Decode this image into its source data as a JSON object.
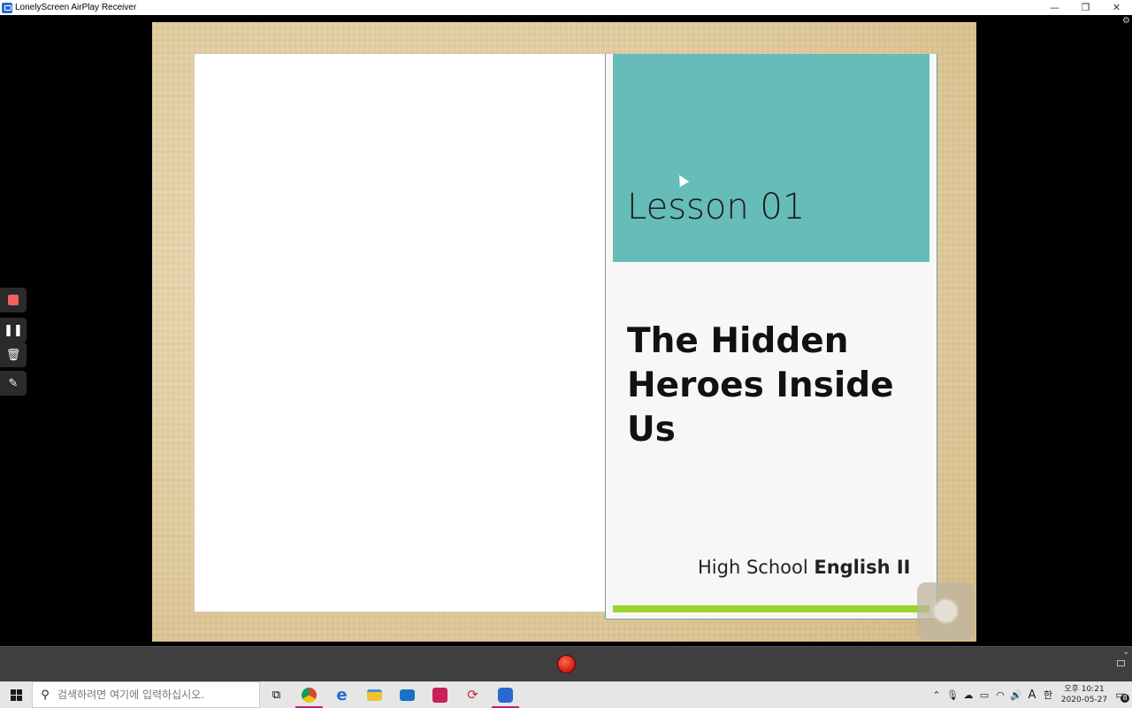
{
  "window": {
    "title": "LonelyScreen AirPlay Receiver",
    "buttons": {
      "minimize": "—",
      "restore": "❐",
      "close": "✕"
    }
  },
  "slide": {
    "lesson": "Lesson 01",
    "headline": "The Hidden Heroes Inside Us",
    "footer_normal": "High School",
    "footer_bold": "English II",
    "colors": {
      "teal": "#65bcb8",
      "green": "#9bd42a"
    }
  },
  "left_toolbar": {
    "items": [
      "stop-recording",
      "pause",
      "delete",
      "annotate"
    ]
  },
  "taskbar": {
    "search_placeholder": "검색하려면 여기에 입력하십시오.",
    "apps": [
      "task-view",
      "chrome",
      "edge",
      "file-explorer",
      "mail",
      "app-red",
      "app-sync",
      "lonelyscreen"
    ],
    "clock_time": "오후 10:21",
    "clock_date": "2020-05-27",
    "ime": "A",
    "ime2": "한",
    "notification_count": "8"
  }
}
